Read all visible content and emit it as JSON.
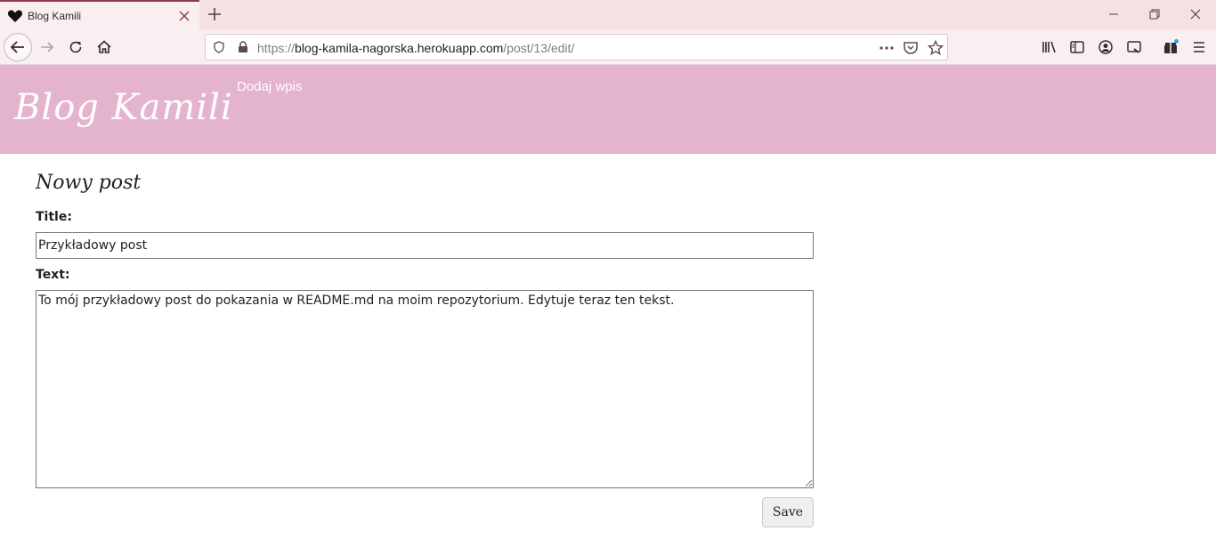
{
  "browser": {
    "tab": {
      "title": "Blog Kamili",
      "favicon": "heart-icon"
    },
    "url": {
      "scheme": "https://",
      "host": "blog-kamila-nagorska.herokuapp.com",
      "path": "/post/13/edit/"
    },
    "icons": [
      "back-icon",
      "forward-icon",
      "reload-icon",
      "home-icon",
      "shield-icon",
      "lock-icon",
      "more-icon",
      "pocket-icon",
      "star-icon",
      "library-icon",
      "sidebar-icon",
      "account-icon",
      "screenshot-icon",
      "extensions-icon",
      "menu-icon",
      "minimize-icon",
      "restore-icon",
      "close-icon",
      "new-tab-icon"
    ]
  },
  "site": {
    "logo": "Blog Kamili",
    "nav": {
      "add_post": "Dodaj wpis"
    },
    "header_color": "#e4b3cd"
  },
  "form": {
    "heading": "Nowy post",
    "title_label": "Title:",
    "title_value": "Przykładowy post",
    "text_label": "Text:",
    "text_value": "To mój przykładowy post do pokazania w README.md na moim repozytorium. Edytuje teraz ten tekst.",
    "save_label": "Save"
  }
}
